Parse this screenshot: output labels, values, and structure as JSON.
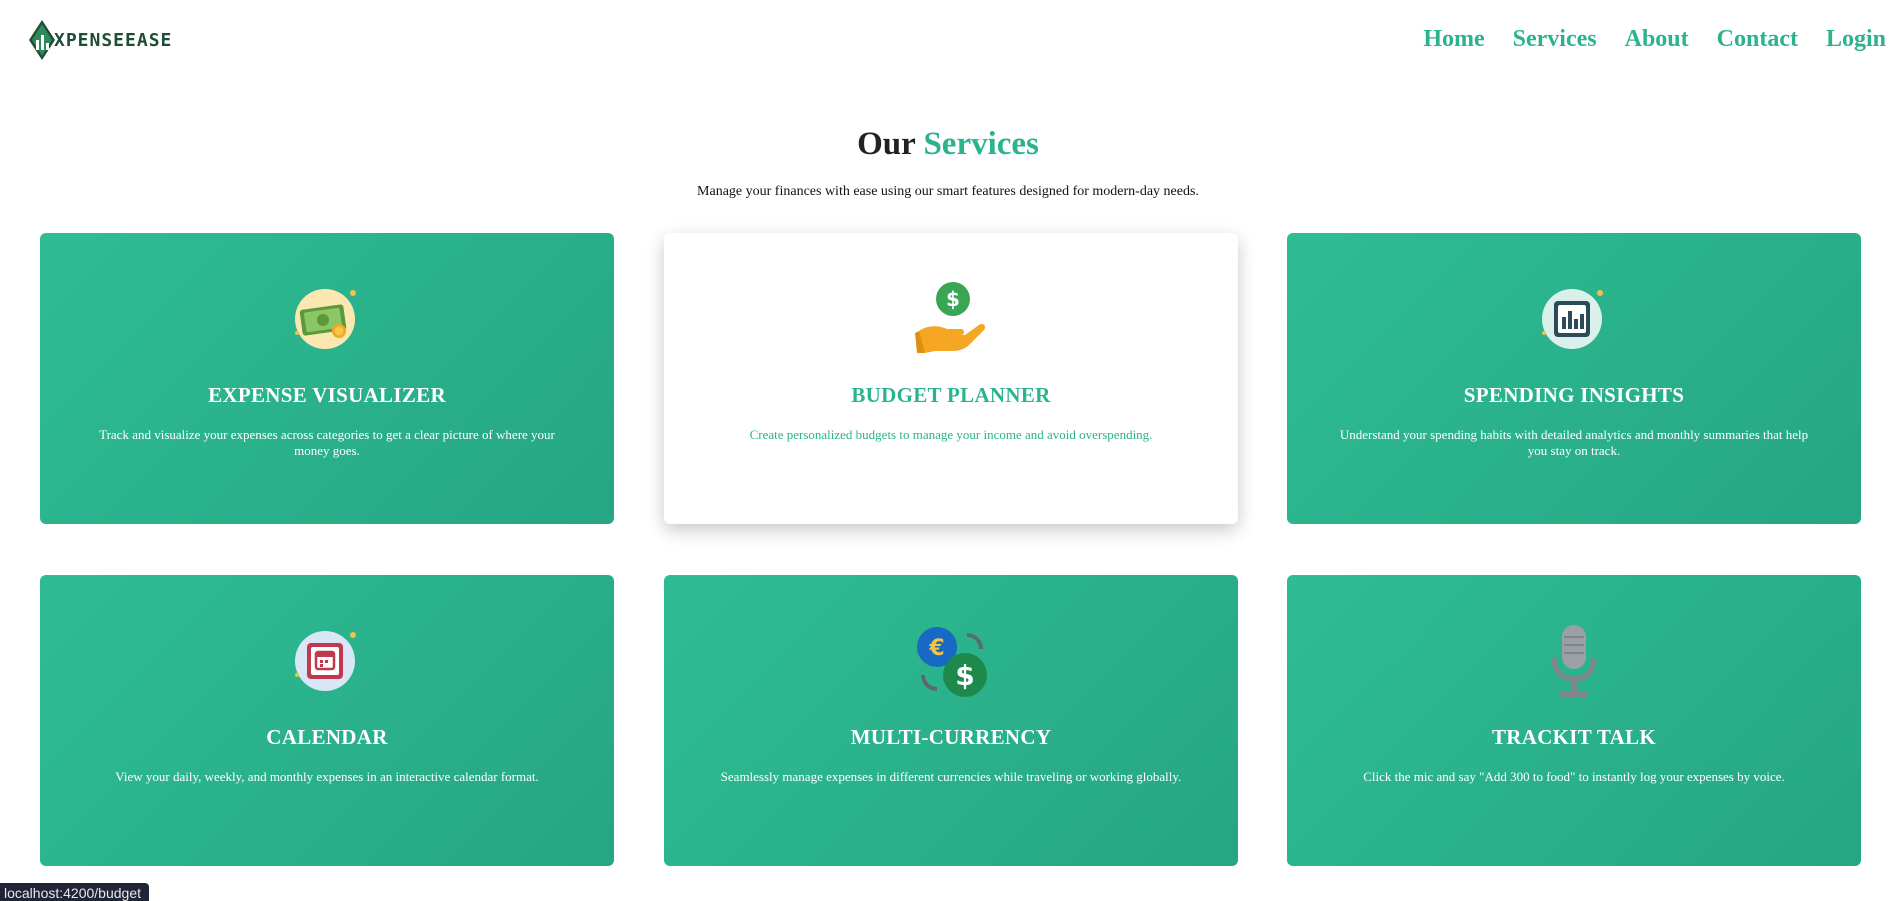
{
  "header": {
    "logo_text": "XPENSEEASE",
    "nav": [
      {
        "label": "Home"
      },
      {
        "label": "Services"
      },
      {
        "label": "About"
      },
      {
        "label": "Contact"
      },
      {
        "label": "Login"
      }
    ]
  },
  "section": {
    "title_part1": "Our",
    "title_part2": "Services",
    "subtitle": "Manage your finances with ease using our smart features designed for modern-day needs."
  },
  "cards": [
    {
      "title": "EXPENSE VISUALIZER",
      "icon": "money-bill-icon",
      "description": "Track and visualize your expenses across categories to get a clear picture of where your money goes."
    },
    {
      "title": "BUDGET PLANNER",
      "icon": "hand-dollar-icon",
      "description": "Create personalized budgets to manage your income and avoid overspending."
    },
    {
      "title": "SPENDING INSIGHTS",
      "icon": "bar-chart-icon",
      "description": "Understand your spending habits with detailed analytics and monthly summaries that help you stay on track."
    },
    {
      "title": "CALENDAR",
      "icon": "calendar-icon",
      "description": "View your daily, weekly, and monthly expenses in an interactive calendar format."
    },
    {
      "title": "MULTI-CURRENCY",
      "icon": "currency-exchange-icon",
      "description": "Seamlessly manage expenses in different currencies while traveling or working globally."
    },
    {
      "title": "TRACKIT TALK",
      "icon": "microphone-icon",
      "description": "Click the mic and say \"Add 300 to food\" to instantly log your expenses by voice."
    }
  ],
  "status_bar": {
    "url": "localhost:4200/budget"
  },
  "colors": {
    "accent": "#2bb38e",
    "card_bg": "#2bb38e",
    "logo_dark": "#1d4d37"
  }
}
